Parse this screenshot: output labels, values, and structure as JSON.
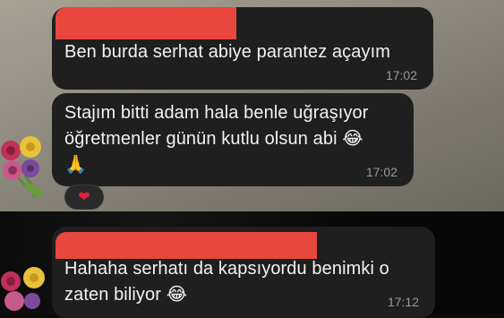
{
  "messages": [
    {
      "text": "Ben burda serhat abiye parantez açayım",
      "time": "17:02"
    },
    {
      "line1": "Stajım bitti adam hala benle uğraşıyor",
      "line2": "öğretmenler günün kutlu olsun abi",
      "emoji_laugh": "😂",
      "emoji_pray": "🙏",
      "time": "17:02",
      "reaction": "❤"
    },
    {
      "line1": "Hahaha serhatı da kapsıyordu benimki o",
      "line2": "zaten biliyor",
      "emoji_laugh": "😂",
      "time": "17:12"
    }
  ],
  "colors": {
    "bubble": "#1f1f1f",
    "redaction": "#e8473d",
    "reaction_heart": "#e3223a"
  }
}
